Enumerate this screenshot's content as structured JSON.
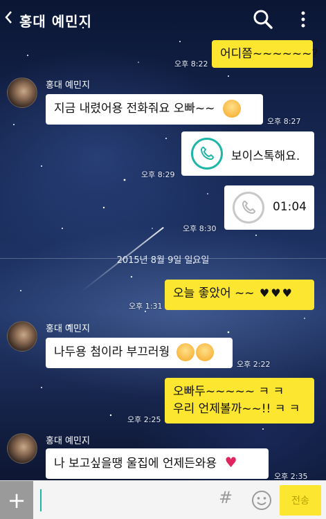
{
  "header": {
    "title": "홍대 예민지",
    "back_icon": "chevron-left-icon",
    "search_icon": "search-icon",
    "more_icon": "more-vertical-icon"
  },
  "messages": {
    "m1": {
      "text": "어디쯤~~~~~~?",
      "time": "오후 8:22"
    },
    "m2": {
      "sender": "홍대 예민지",
      "text": "지금 내렸어용 전화줘요 오빠~~",
      "time": "오후 8:27"
    },
    "m3": {
      "text": "보이스톡해요.",
      "time": "오후 8:29"
    },
    "m4": {
      "text": "01:04",
      "time": "오후 8:30"
    },
    "date_divider": "2015년 8월 9일 일요일",
    "m5": {
      "text": "오늘 좋았어 ~~",
      "time": "오후 1:31"
    },
    "m6": {
      "sender": "홍대 예민지",
      "text": "나두용 첨이라 부끄러웡",
      "time": "오후 2:22"
    },
    "m7": {
      "line1": "오빠두~~~~~ ㅋ ㅋ",
      "line2": "우리 언제볼까~~!! ㅋ ㅋ",
      "time": "오후 2:25"
    },
    "m8": {
      "sender": "홍대 예민지",
      "text": "나 보고싶을땡 울집에 언제든와용",
      "time": "오후 2:35"
    }
  },
  "input_bar": {
    "placeholder": "",
    "send_label": "전송",
    "hash_label": "#",
    "plus_label": "+"
  },
  "colors": {
    "yellow_bubble": "#fde62f",
    "white_bubble": "#ffffff",
    "voice_call_accent": "#1fb5a9"
  }
}
